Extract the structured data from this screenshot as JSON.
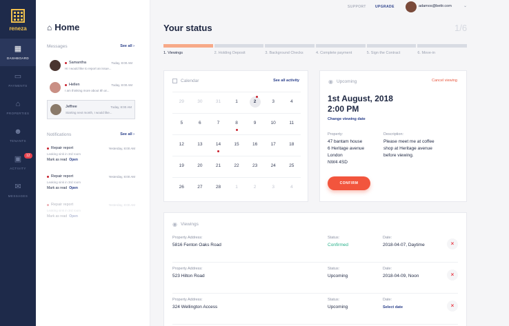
{
  "brand": {
    "name": "reneza"
  },
  "sidebar": {
    "items": [
      {
        "label": "DASHBOARD",
        "icon": "dashboard-icon"
      },
      {
        "label": "PAYMENTS",
        "icon": "card-icon"
      },
      {
        "label": "PROPERTIES",
        "icon": "home-icon"
      },
      {
        "label": "TENANTS",
        "icon": "users-icon"
      },
      {
        "label": "ACTIVITY",
        "icon": "calendar-icon",
        "badge": "12"
      },
      {
        "label": "MESSAGES",
        "icon": "mail-icon"
      }
    ]
  },
  "home": {
    "title": "Home",
    "messages_title": "Messages",
    "notifications_title": "Notifications",
    "see_all": "See all",
    "messages": [
      {
        "name": "Samantha",
        "time": "Today, 8:00 AM",
        "text": "Hi I would like to report an issue..."
      },
      {
        "name": "Hellen",
        "time": "Today, 8:00 AM",
        "text": "I am thinking more about 8h ar..."
      },
      {
        "name": "Jeffree",
        "time": "Today, 8:00 AM",
        "text": "Starting next month, I would like..."
      }
    ],
    "notifications": [
      {
        "title": "Repair report",
        "time": "Yesterday, 8:00 AM",
        "sub": "Leaking sink in 3rd room",
        "mark": "Mark as read",
        "open": "Open"
      },
      {
        "title": "Repair report",
        "time": "Yesterday, 8:00 AM",
        "sub": "Leaking sink in 3rd room",
        "mark": "Mark as read",
        "open": "Open"
      },
      {
        "title": "Repair report",
        "time": "Yesterday, 8:00 AM",
        "sub": "Leaking sink in 3rd room",
        "mark": "Mark as read",
        "open": "Open"
      }
    ]
  },
  "topbar": {
    "support": "SUPPORT",
    "upgrade": "UPGRADE",
    "email": "adamos@bettr.com"
  },
  "status": {
    "title": "Your status",
    "count": "1/6",
    "steps": [
      "1. Viewings",
      "2. Holding Deposit",
      "3. Background Checks",
      "4. Complete payment",
      "5. Sign the Contract",
      "6. Move-in"
    ],
    "active_step": 1
  },
  "calendar": {
    "title": "Calendar",
    "link": "See all activity",
    "rows": [
      [
        "29",
        "30",
        "31",
        "1",
        "2",
        "3",
        "4"
      ],
      [
        "5",
        "6",
        "7",
        "8",
        "9",
        "10",
        "11"
      ],
      [
        "12",
        "13",
        "14",
        "15",
        "16",
        "17",
        "18"
      ],
      [
        "19",
        "20",
        "21",
        "22",
        "23",
        "24",
        "25"
      ],
      [
        "26",
        "27",
        "28",
        "1",
        "2",
        "3",
        "4"
      ]
    ]
  },
  "upcoming": {
    "title": "Upcoming",
    "cancel": "Cancel viewing",
    "date_line1": "1st August, 2018",
    "date_line2": "2:00 PM",
    "change": "Change viewing date",
    "property_label": "Property:",
    "property_value": "47 bantam house\n6 Heritage avenue\nLondon\nNW4 4SD",
    "description_label": "Description:",
    "description_value": "Please meet me at coffee\nshop at Heritage avenue\nbefore viewing.",
    "confirm": "CONFIRM"
  },
  "viewings": {
    "title": "Viewings",
    "rows": [
      {
        "address_label": "Property Address:",
        "address": "5816 Fenton Oaks Road",
        "status_label": "Status:",
        "status": "Confirmed",
        "date_label": "Date:",
        "date": "2018-04-07, Daytime"
      },
      {
        "address_label": "Property Address:",
        "address": "523 Hilton Road",
        "status_label": "Status:",
        "status": "Upcoming",
        "date_label": "Date:",
        "date": "2018-04-09, Noon"
      },
      {
        "address_label": "Property Address:",
        "address": "324 Wellington Access",
        "status_label": "Status:",
        "status": "Upcoming",
        "date_label": "Date:",
        "date": "Select date"
      }
    ]
  }
}
